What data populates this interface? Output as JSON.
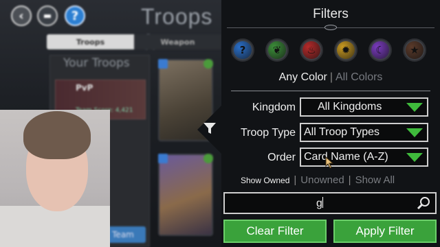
{
  "background": {
    "title": "Troops &",
    "tabs": [
      "Troops",
      "Weapon"
    ],
    "your_troops_label": "Your Troops",
    "pvp_label": "PvP",
    "team_score": "Team Score: 4,421",
    "team_button": "Team"
  },
  "filters": {
    "title": "Filters",
    "color_orbs": [
      {
        "name": "blue",
        "color": "#2a6fc9",
        "glyph": "?"
      },
      {
        "name": "green",
        "color": "#3c8f3a",
        "glyph": "❦"
      },
      {
        "name": "red",
        "color": "#b52a2a",
        "glyph": "♨"
      },
      {
        "name": "yellow",
        "color": "#c99a21",
        "glyph": "✹"
      },
      {
        "name": "purple",
        "color": "#7a3bbf",
        "glyph": "☾"
      },
      {
        "name": "brown",
        "color": "#5a3a2a",
        "glyph": "★"
      }
    ],
    "color_mode": {
      "active": "Any Color",
      "separator": "|",
      "inactive": "All Colors"
    },
    "kingdom": {
      "label": "Kingdom",
      "value": "All Kingdoms"
    },
    "troop_type": {
      "label": "Troop Type",
      "value": "All Troop Types"
    },
    "order": {
      "label": "Order",
      "value": "Card Name (A-Z)"
    },
    "ownership": {
      "active": "Show Owned",
      "sep1": "|",
      "option2": "Unowned",
      "sep2": "|",
      "option3": "Show All"
    },
    "search_value": "g",
    "clear_label": "Clear Filter",
    "apply_label": "Apply Filter"
  }
}
